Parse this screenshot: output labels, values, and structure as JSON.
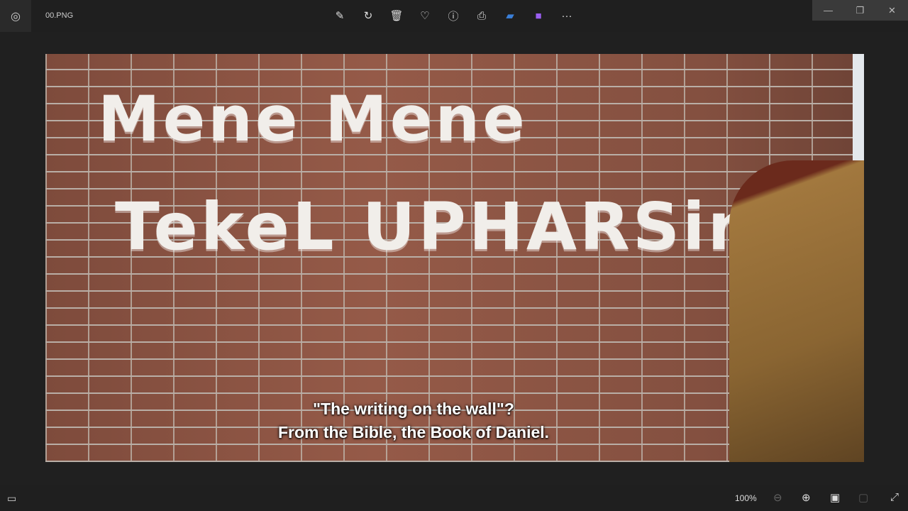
{
  "titlebar": {
    "filename": "00.PNG",
    "app_icon": "photos-icon"
  },
  "toolbar": {
    "items": [
      {
        "name": "edit-image-button",
        "glyph": "✎"
      },
      {
        "name": "rotate-button",
        "glyph": "↻"
      },
      {
        "name": "delete-button",
        "glyph": "🗑"
      },
      {
        "name": "favorite-button",
        "glyph": "♡"
      },
      {
        "name": "info-button",
        "glyph": "ⓘ"
      },
      {
        "name": "print-button",
        "glyph": "⎙"
      },
      {
        "name": "clipchamp-button",
        "glyph": "▰"
      },
      {
        "name": "designer-button",
        "glyph": "■"
      },
      {
        "name": "more-button",
        "glyph": "···"
      }
    ]
  },
  "window": {
    "minimize": "—",
    "maximize": "❐",
    "close": "✕"
  },
  "photo": {
    "graffiti_line1": "Mene Mene",
    "graffiti_line2": "TekeL UPHARSin",
    "subtitle_line1": "\"The writing on the wall\"?",
    "subtitle_line2": "From the Bible, the Book of Daniel."
  },
  "statusbar": {
    "zoom": "100%"
  }
}
